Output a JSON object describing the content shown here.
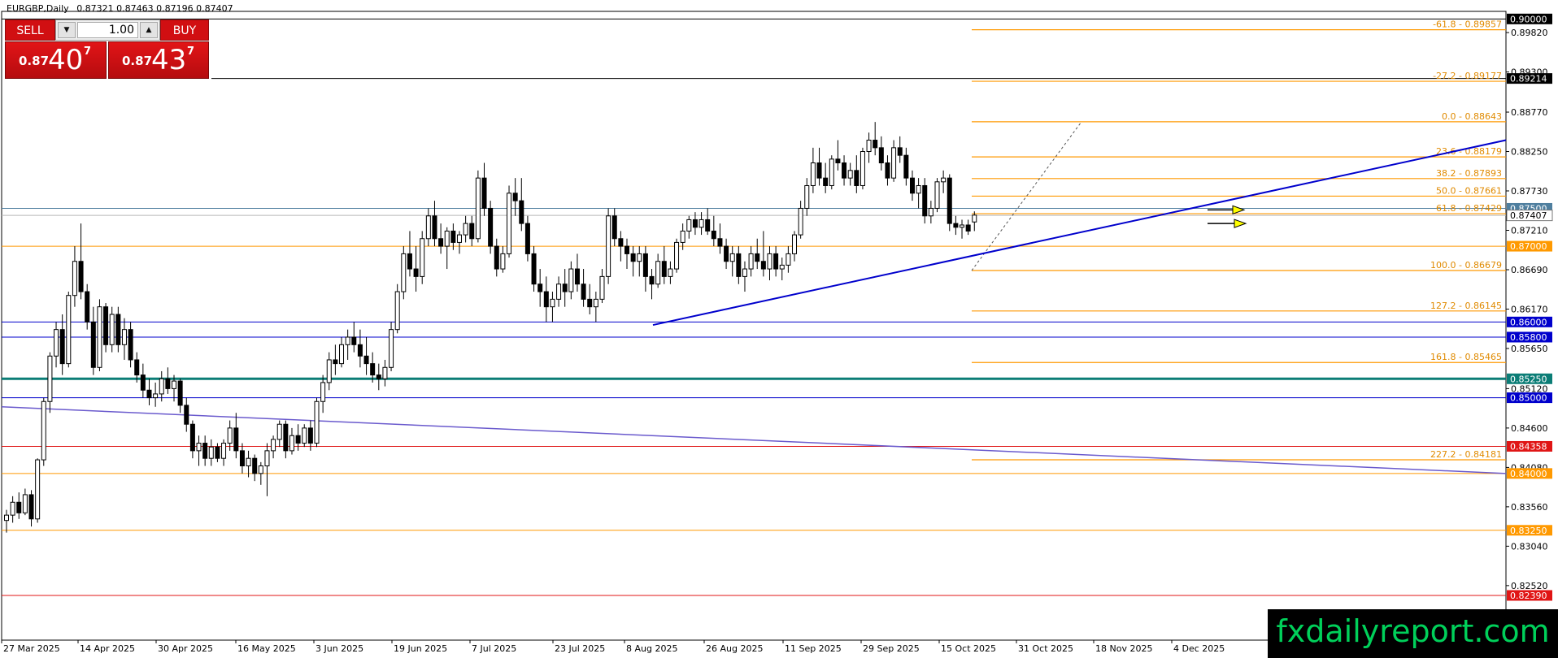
{
  "header": {
    "symbol": "EURGBP,Daily",
    "ohlc": "0.87321 0.87463 0.87196 0.87407"
  },
  "trade_panel": {
    "sell_label": "SELL",
    "buy_label": "BUY",
    "lot": "1.00",
    "sell_price_small": "0.87",
    "sell_price_big": "40",
    "sell_price_sup": "7",
    "buy_price_small": "0.87",
    "buy_price_big": "43",
    "buy_price_sup": "7",
    "down_icon": "chevron-down-icon",
    "up_icon": "chevron-up-icon"
  },
  "brand": "fxdailyreport.com",
  "chart_data": {
    "type": "candlestick",
    "symbol": "EURGBP",
    "timeframe": "Daily",
    "ylim": [
      0.818,
      0.901
    ],
    "grid": false,
    "x_ticks": [
      "27 Mar 2025",
      "14 Apr 2025",
      "30 Apr 2025",
      "16 May 2025",
      "3 Jun 2025",
      "19 Jun 2025",
      "7 Jul 2025",
      "23 Jul 2025",
      "8 Aug 2025",
      "26 Aug 2025",
      "11 Sep 2025",
      "29 Sep 2025",
      "15 Oct 2025",
      "31 Oct 2025",
      "18 Nov 2025",
      "4 Dec 2025"
    ],
    "y_ticks": [
      "0.89820",
      "0.89300",
      "0.88770",
      "0.88250",
      "0.87730",
      "0.87210",
      "0.86690",
      "0.86170",
      "0.85650",
      "0.85120",
      "0.84600",
      "0.84080",
      "0.83560",
      "0.83040",
      "0.82520"
    ],
    "current_price": "0.87407",
    "levels": [
      {
        "label": "0.90000",
        "price": 0.9,
        "color": "#000000"
      },
      {
        "label": "0.89214",
        "price": 0.89214,
        "color": "#000000"
      },
      {
        "label": "0.87500",
        "price": 0.875,
        "color": "#4f7f9f"
      },
      {
        "label": "0.87000",
        "price": 0.87,
        "color": "#ff9900"
      },
      {
        "label": "0.86000",
        "price": 0.86,
        "color": "#0000cc"
      },
      {
        "label": "0.85800",
        "price": 0.858,
        "color": "#0000cc"
      },
      {
        "label": "0.85250",
        "price": 0.8525,
        "color": "#0b7d76"
      },
      {
        "label": "0.85000",
        "price": 0.85,
        "color": "#0000cc"
      },
      {
        "label": "0.84358",
        "price": 0.84358,
        "color": "#e01515"
      },
      {
        "label": "0.84000",
        "price": 0.84,
        "color": "#ff9900"
      },
      {
        "label": "0.83250",
        "price": 0.8325,
        "color": "#ff9900"
      },
      {
        "label": "0.82390",
        "price": 0.8239,
        "color": "#e01515"
      }
    ],
    "fib_levels": [
      {
        "label": "-61.8 - 0.89857",
        "price": 0.89857
      },
      {
        "label": "-27.2 - 0.89177",
        "price": 0.89177
      },
      {
        "label": "0.0 - 0.88643",
        "price": 0.88643
      },
      {
        "label": "23.6 - 0.88179",
        "price": 0.88179
      },
      {
        "label": "38.2 - 0.87893",
        "price": 0.87893
      },
      {
        "label": "50.0 - 0.87661",
        "price": 0.87661
      },
      {
        "label": "61.8 - 0.87429",
        "price": 0.87429
      },
      {
        "label": "100.0 - 0.86679",
        "price": 0.86679
      },
      {
        "label": "127.2 - 0.86145",
        "price": 0.86145
      },
      {
        "label": "161.8 - 0.85465",
        "price": 0.85465
      },
      {
        "label": "227.2 - 0.84181",
        "price": 0.84181
      }
    ],
    "trendlines": [
      {
        "name": "uptrend-support",
        "from": [
          "8 Aug 2025",
          0.8596
        ],
        "to": [
          "12 Dec 2025",
          0.884
        ],
        "color": "#0000cc"
      },
      {
        "name": "long-downtrend",
        "from": [
          "27 Mar 2025",
          0.8488
        ],
        "to": [
          "12 Dec 2025",
          0.84
        ],
        "color": "#6a5acd"
      }
    ],
    "candles": [
      [
        0.8338,
        0.8352,
        0.8322,
        0.8345
      ],
      [
        0.8345,
        0.837,
        0.8335,
        0.8362
      ],
      [
        0.8362,
        0.8375,
        0.834,
        0.8348
      ],
      [
        0.8348,
        0.838,
        0.8345,
        0.8372
      ],
      [
        0.8372,
        0.8378,
        0.833,
        0.834
      ],
      [
        0.834,
        0.842,
        0.8335,
        0.8418
      ],
      [
        0.8418,
        0.85,
        0.841,
        0.8495
      ],
      [
        0.8495,
        0.856,
        0.848,
        0.8555
      ],
      [
        0.8555,
        0.86,
        0.854,
        0.859
      ],
      [
        0.859,
        0.861,
        0.853,
        0.8545
      ],
      [
        0.8545,
        0.864,
        0.854,
        0.8635
      ],
      [
        0.8635,
        0.87,
        0.862,
        0.868
      ],
      [
        0.868,
        0.873,
        0.863,
        0.864
      ],
      [
        0.864,
        0.865,
        0.859,
        0.86
      ],
      [
        0.86,
        0.862,
        0.853,
        0.854
      ],
      [
        0.854,
        0.863,
        0.8535,
        0.862
      ],
      [
        0.862,
        0.8625,
        0.856,
        0.857
      ],
      [
        0.857,
        0.862,
        0.856,
        0.861
      ],
      [
        0.861,
        0.862,
        0.856,
        0.857
      ],
      [
        0.857,
        0.8605,
        0.855,
        0.859
      ],
      [
        0.859,
        0.86,
        0.854,
        0.855
      ],
      [
        0.855,
        0.856,
        0.852,
        0.853
      ],
      [
        0.853,
        0.8545,
        0.85,
        0.851
      ],
      [
        0.851,
        0.8525,
        0.849,
        0.85
      ],
      [
        0.85,
        0.852,
        0.8488,
        0.8505
      ],
      [
        0.8505,
        0.8535,
        0.8495,
        0.8525
      ],
      [
        0.8525,
        0.854,
        0.8505,
        0.8512
      ],
      [
        0.8512,
        0.853,
        0.8495,
        0.8522
      ],
      [
        0.8522,
        0.8525,
        0.848,
        0.849
      ],
      [
        0.849,
        0.85,
        0.8455,
        0.8465
      ],
      [
        0.8465,
        0.847,
        0.842,
        0.843
      ],
      [
        0.843,
        0.845,
        0.841,
        0.844
      ],
      [
        0.844,
        0.845,
        0.841,
        0.842
      ],
      [
        0.842,
        0.8445,
        0.841,
        0.8435
      ],
      [
        0.8435,
        0.844,
        0.8415,
        0.842
      ],
      [
        0.842,
        0.8445,
        0.841,
        0.844
      ],
      [
        0.844,
        0.847,
        0.843,
        0.846
      ],
      [
        0.846,
        0.848,
        0.842,
        0.843
      ],
      [
        0.843,
        0.844,
        0.84,
        0.841
      ],
      [
        0.841,
        0.843,
        0.8395,
        0.842
      ],
      [
        0.842,
        0.8425,
        0.839,
        0.84
      ],
      [
        0.84,
        0.8415,
        0.8385,
        0.841
      ],
      [
        0.841,
        0.844,
        0.837,
        0.843
      ],
      [
        0.843,
        0.845,
        0.842,
        0.8445
      ],
      [
        0.8445,
        0.847,
        0.8435,
        0.8465
      ],
      [
        0.8465,
        0.847,
        0.842,
        0.843
      ],
      [
        0.843,
        0.846,
        0.8425,
        0.845
      ],
      [
        0.845,
        0.8465,
        0.843,
        0.844
      ],
      [
        0.844,
        0.8465,
        0.8435,
        0.846
      ],
      [
        0.846,
        0.847,
        0.843,
        0.844
      ],
      [
        0.844,
        0.85,
        0.8435,
        0.8495
      ],
      [
        0.8495,
        0.853,
        0.848,
        0.852
      ],
      [
        0.852,
        0.856,
        0.851,
        0.855
      ],
      [
        0.855,
        0.857,
        0.853,
        0.8545
      ],
      [
        0.8545,
        0.858,
        0.854,
        0.857
      ],
      [
        0.857,
        0.859,
        0.855,
        0.858
      ],
      [
        0.858,
        0.86,
        0.856,
        0.857
      ],
      [
        0.857,
        0.859,
        0.854,
        0.8555
      ],
      [
        0.8555,
        0.858,
        0.853,
        0.8545
      ],
      [
        0.8545,
        0.856,
        0.852,
        0.853
      ],
      [
        0.853,
        0.8545,
        0.851,
        0.8525
      ],
      [
        0.8525,
        0.855,
        0.8515,
        0.854
      ],
      [
        0.854,
        0.86,
        0.8535,
        0.859
      ],
      [
        0.859,
        0.865,
        0.8585,
        0.864
      ],
      [
        0.864,
        0.87,
        0.863,
        0.869
      ],
      [
        0.869,
        0.872,
        0.866,
        0.867
      ],
      [
        0.867,
        0.87,
        0.864,
        0.866
      ],
      [
        0.866,
        0.872,
        0.865,
        0.871
      ],
      [
        0.871,
        0.875,
        0.87,
        0.874
      ],
      [
        0.874,
        0.876,
        0.87,
        0.871
      ],
      [
        0.871,
        0.873,
        0.869,
        0.87
      ],
      [
        0.87,
        0.8725,
        0.867,
        0.872
      ],
      [
        0.872,
        0.873,
        0.8695,
        0.8705
      ],
      [
        0.8705,
        0.872,
        0.869,
        0.8715
      ],
      [
        0.8715,
        0.874,
        0.8705,
        0.873
      ],
      [
        0.873,
        0.874,
        0.87,
        0.871
      ],
      [
        0.871,
        0.88,
        0.8705,
        0.879
      ],
      [
        0.879,
        0.881,
        0.874,
        0.875
      ],
      [
        0.875,
        0.876,
        0.869,
        0.87
      ],
      [
        0.87,
        0.871,
        0.866,
        0.867
      ],
      [
        0.867,
        0.87,
        0.8665,
        0.869
      ],
      [
        0.869,
        0.878,
        0.8685,
        0.877
      ],
      [
        0.877,
        0.879,
        0.874,
        0.876
      ],
      [
        0.876,
        0.879,
        0.872,
        0.873
      ],
      [
        0.873,
        0.874,
        0.868,
        0.869
      ],
      [
        0.869,
        0.87,
        0.864,
        0.865
      ],
      [
        0.865,
        0.867,
        0.862,
        0.864
      ],
      [
        0.864,
        0.866,
        0.86,
        0.862
      ],
      [
        0.862,
        0.864,
        0.86,
        0.863
      ],
      [
        0.863,
        0.866,
        0.862,
        0.865
      ],
      [
        0.865,
        0.867,
        0.862,
        0.864
      ],
      [
        0.864,
        0.868,
        0.863,
        0.867
      ],
      [
        0.867,
        0.869,
        0.864,
        0.865
      ],
      [
        0.865,
        0.867,
        0.862,
        0.863
      ],
      [
        0.863,
        0.865,
        0.861,
        0.862
      ],
      [
        0.862,
        0.864,
        0.86,
        0.863
      ],
      [
        0.863,
        0.867,
        0.8625,
        0.866
      ],
      [
        0.866,
        0.875,
        0.865,
        0.874
      ],
      [
        0.874,
        0.875,
        0.87,
        0.871
      ],
      [
        0.871,
        0.872,
        0.868,
        0.87
      ],
      [
        0.87,
        0.871,
        0.867,
        0.869
      ],
      [
        0.869,
        0.87,
        0.866,
        0.868
      ],
      [
        0.868,
        0.87,
        0.866,
        0.869
      ],
      [
        0.869,
        0.87,
        0.864,
        0.866
      ],
      [
        0.866,
        0.867,
        0.863,
        0.865
      ],
      [
        0.865,
        0.869,
        0.8645,
        0.868
      ],
      [
        0.868,
        0.87,
        0.865,
        0.866
      ],
      [
        0.866,
        0.868,
        0.865,
        0.867
      ],
      [
        0.867,
        0.871,
        0.8665,
        0.8705
      ],
      [
        0.8705,
        0.873,
        0.8695,
        0.872
      ],
      [
        0.872,
        0.874,
        0.871,
        0.8735
      ],
      [
        0.8735,
        0.8745,
        0.8715,
        0.8725
      ],
      [
        0.8725,
        0.8745,
        0.8715,
        0.8735
      ],
      [
        0.8735,
        0.875,
        0.8715,
        0.872
      ],
      [
        0.872,
        0.874,
        0.87,
        0.871
      ],
      [
        0.871,
        0.873,
        0.869,
        0.87
      ],
      [
        0.87,
        0.871,
        0.867,
        0.868
      ],
      [
        0.868,
        0.87,
        0.866,
        0.869
      ],
      [
        0.869,
        0.87,
        0.865,
        0.866
      ],
      [
        0.866,
        0.868,
        0.864,
        0.867
      ],
      [
        0.867,
        0.87,
        0.866,
        0.869
      ],
      [
        0.869,
        0.871,
        0.867,
        0.868
      ],
      [
        0.868,
        0.872,
        0.866,
        0.867
      ],
      [
        0.867,
        0.87,
        0.8655,
        0.869
      ],
      [
        0.869,
        0.87,
        0.866,
        0.867
      ],
      [
        0.867,
        0.8685,
        0.8655,
        0.8675
      ],
      [
        0.8675,
        0.87,
        0.8665,
        0.869
      ],
      [
        0.869,
        0.872,
        0.868,
        0.8715
      ],
      [
        0.8715,
        0.876,
        0.871,
        0.875
      ],
      [
        0.875,
        0.879,
        0.874,
        0.878
      ],
      [
        0.878,
        0.883,
        0.877,
        0.881
      ],
      [
        0.881,
        0.883,
        0.878,
        0.879
      ],
      [
        0.879,
        0.881,
        0.877,
        0.878
      ],
      [
        0.878,
        0.882,
        0.8775,
        0.8815
      ],
      [
        0.8815,
        0.884,
        0.88,
        0.881
      ],
      [
        0.881,
        0.882,
        0.878,
        0.879
      ],
      [
        0.879,
        0.881,
        0.878,
        0.88
      ],
      [
        0.88,
        0.882,
        0.877,
        0.878
      ],
      [
        0.878,
        0.883,
        0.8775,
        0.8825
      ],
      [
        0.8825,
        0.885,
        0.881,
        0.884
      ],
      [
        0.884,
        0.8864,
        0.882,
        0.883
      ],
      [
        0.883,
        0.8845,
        0.88,
        0.881
      ],
      [
        0.881,
        0.882,
        0.878,
        0.879
      ],
      [
        0.879,
        0.884,
        0.8785,
        0.883
      ],
      [
        0.883,
        0.8845,
        0.881,
        0.882
      ],
      [
        0.882,
        0.883,
        0.878,
        0.879
      ],
      [
        0.879,
        0.88,
        0.876,
        0.877
      ],
      [
        0.877,
        0.879,
        0.875,
        0.878
      ],
      [
        0.878,
        0.879,
        0.873,
        0.874
      ],
      [
        0.874,
        0.876,
        0.873,
        0.875
      ],
      [
        0.875,
        0.879,
        0.8745,
        0.8785
      ],
      [
        0.8785,
        0.88,
        0.877,
        0.879
      ],
      [
        0.879,
        0.8795,
        0.872,
        0.873
      ],
      [
        0.873,
        0.874,
        0.8715,
        0.8725
      ],
      [
        0.8725,
        0.8735,
        0.871,
        0.8728
      ],
      [
        0.8728,
        0.8735,
        0.8715,
        0.872
      ],
      [
        0.8732,
        0.8746,
        0.872,
        0.8741
      ]
    ]
  }
}
